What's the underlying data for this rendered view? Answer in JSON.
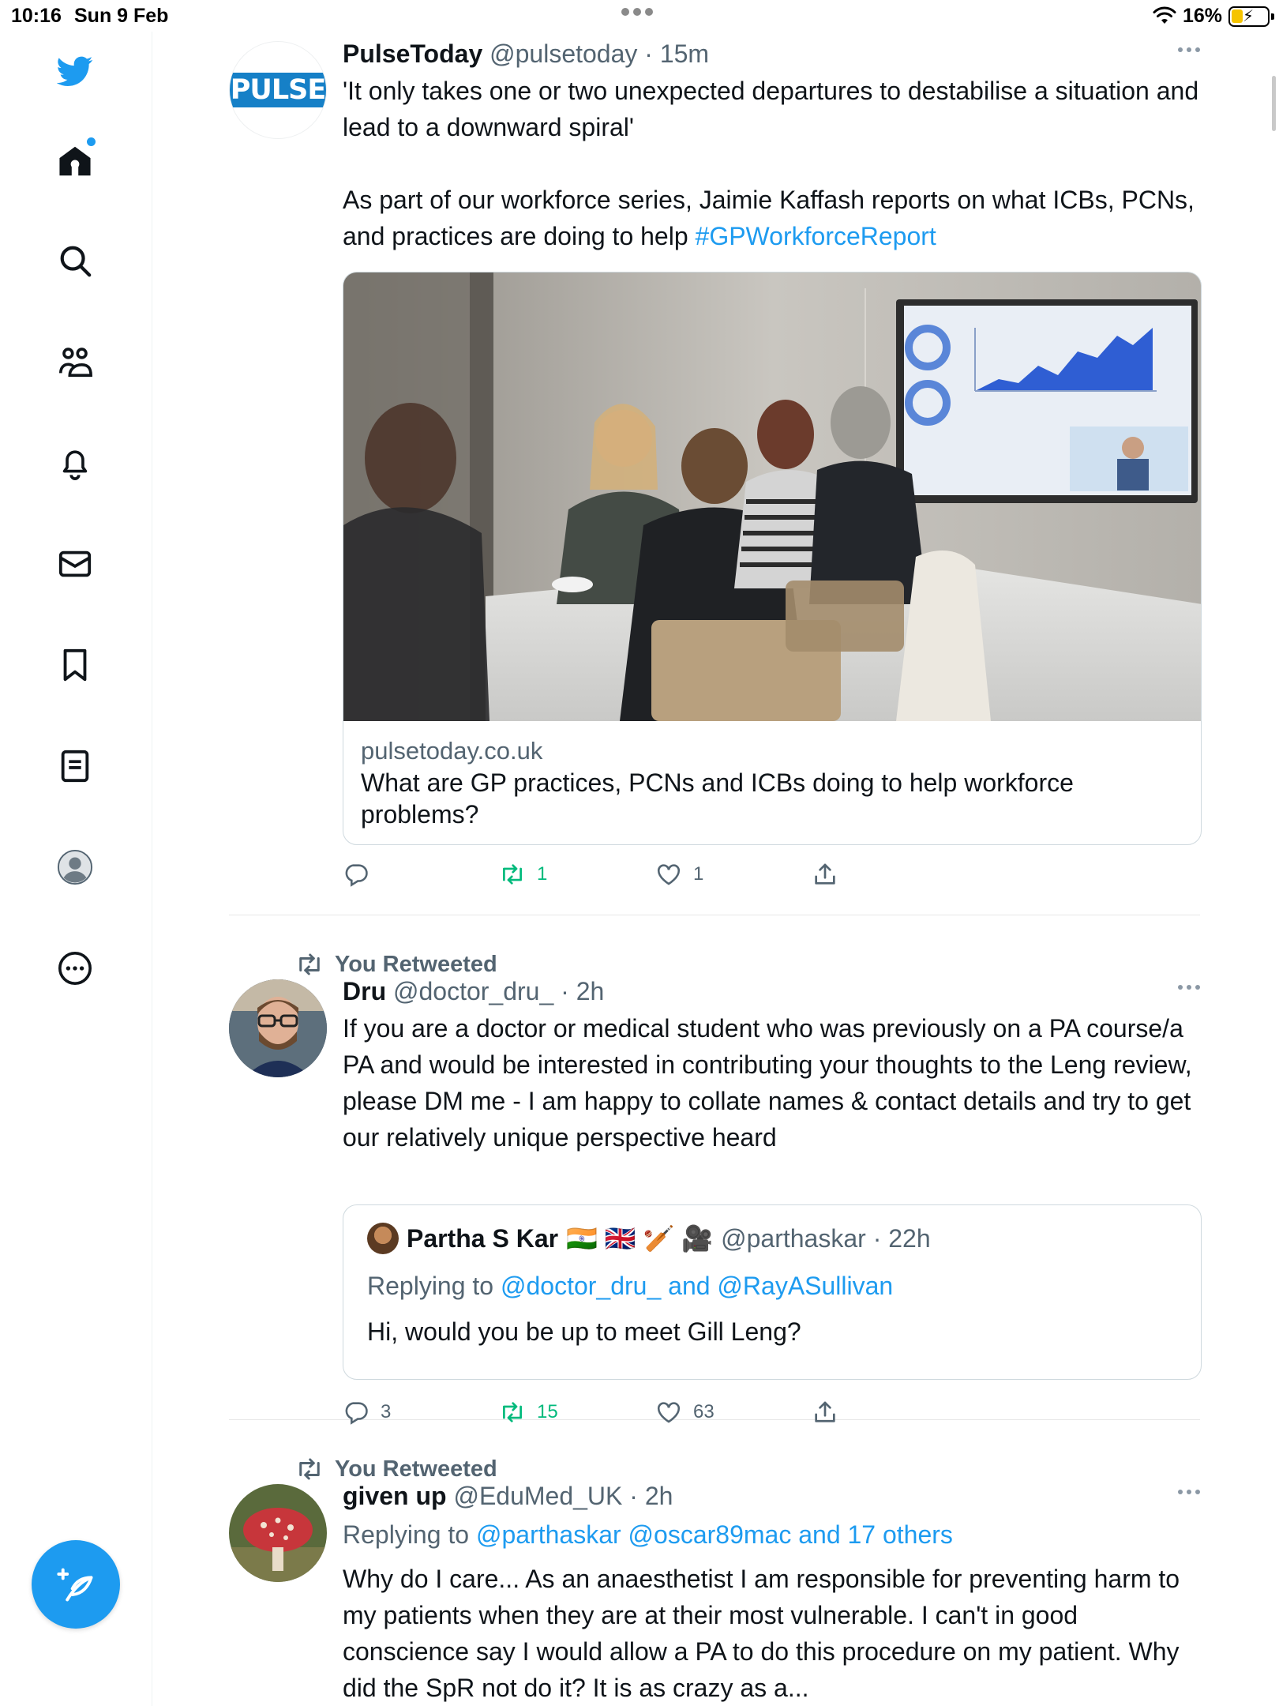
{
  "status_bar": {
    "time": "10:16",
    "date": "Sun 9 Feb",
    "battery": "16%"
  },
  "sidebar": {
    "items": [
      {
        "name": "twitter-logo-icon"
      },
      {
        "name": "home-icon"
      },
      {
        "name": "search-icon"
      },
      {
        "name": "communities-icon"
      },
      {
        "name": "notifications-icon"
      },
      {
        "name": "messages-icon"
      },
      {
        "name": "bookmarks-icon"
      },
      {
        "name": "lists-icon"
      },
      {
        "name": "profile-icon"
      },
      {
        "name": "more-icon"
      }
    ],
    "compose_icon": "compose-icon"
  },
  "tweets": [
    {
      "author_name": "PulseToday",
      "author_handle_time": "@pulsetoday · 15m",
      "avatar_text": "PULSE",
      "text_p1": "'It only takes one or two unexpected departures to destabilise a situation and lead to a downward spiral'",
      "text_p2": "As part of our workforce series, Jaimie Kaffash reports on what ICBs, PCNs, and practices are doing to help ",
      "hashtag": "#GPWorkforceReport",
      "card": {
        "domain": "pulsetoday.co.uk",
        "title": "What are GP practices, PCNs and ICBs doing to help workforce problems?"
      },
      "replies": "",
      "retweets": "1",
      "likes": "1"
    },
    {
      "retweet_label": "You Retweeted",
      "author_name": "Dru",
      "author_handle_time": "@doctor_dru_ · 2h",
      "text": "If you are a doctor or medical student who was previously on a PA course/a PA and would be interested in contributing your thoughts to the Leng review, please DM me - I am happy to collate names & contact details and try to get our relatively unique perspective heard",
      "quote": {
        "name": "Partha S Kar",
        "emojis": "🇮🇳 🇬🇧 🏏 🎥",
        "handle_time": "@parthaskar · 22h",
        "replying_prefix": "Replying to ",
        "replying_users": "@doctor_dru_ and @RayASullivan",
        "text": "Hi, would you be up to meet Gill Leng?"
      },
      "replies": "3",
      "retweets": "15",
      "likes": "63"
    },
    {
      "retweet_label": "You Retweeted",
      "author_name": "given up",
      "author_handle_time": "@EduMed_UK · 2h",
      "replying_prefix": "Replying to ",
      "replying_users": "@parthaskar @oscar89mac and 17 others",
      "text": "Why do I care... As an anaesthetist I am responsible for preventing harm to my patients when they are at their most vulnerable. I can't in good conscience say I would allow a PA to do this procedure on my patient. Why did the SpR not do it? It is as crazy as a..."
    }
  ],
  "colors": {
    "accent": "#1d9bf0",
    "retweet": "#00ba7c",
    "muted": "#536471"
  }
}
